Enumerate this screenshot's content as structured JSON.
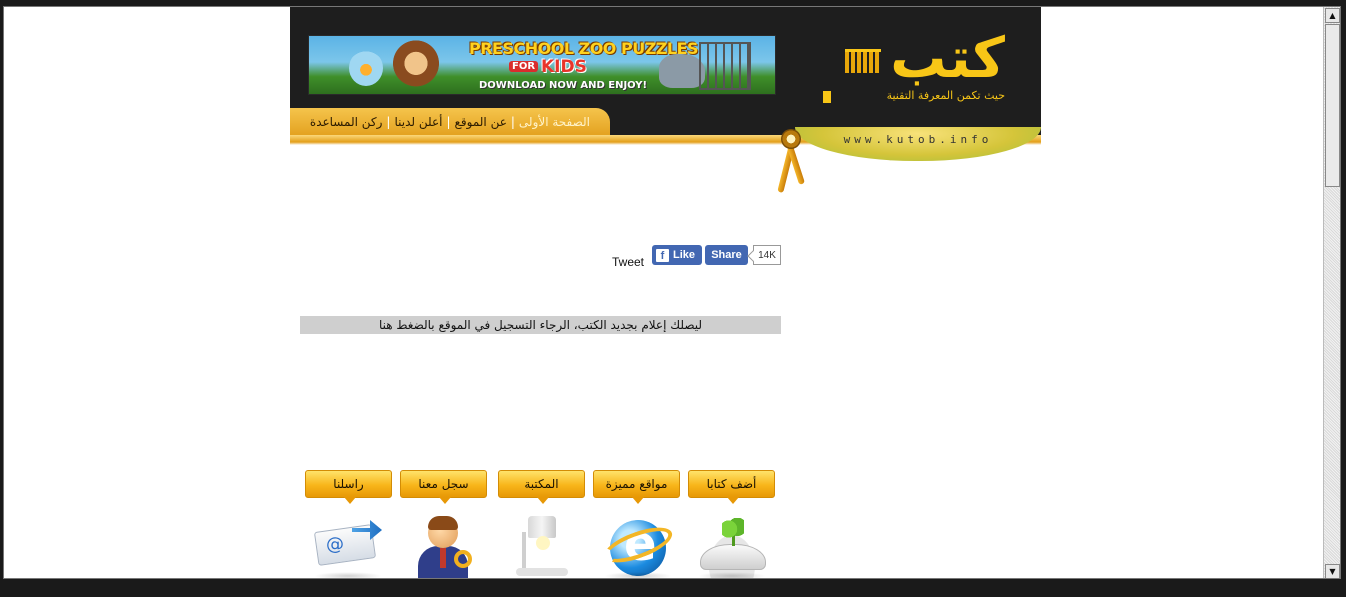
{
  "site": {
    "url_label": "www.kutob.info",
    "logo_text": "كتب",
    "logo_tagline": "حيث تكمن المعرفة التقنية"
  },
  "ad": {
    "title": "PRESCHOOL ZOO PUZZLES",
    "for_label": "FOR",
    "kids_label": "KIDS",
    "cta": "DOWNLOAD NOW AND ENJOY!"
  },
  "nav": {
    "items": [
      {
        "label": "الصفحة الأولى"
      },
      {
        "label": "عن الموقع"
      },
      {
        "label": "أعلن لدينا"
      },
      {
        "label": "ركن المساعدة"
      }
    ],
    "separator": "|"
  },
  "social": {
    "tweet_label": "Tweet",
    "like_label": "Like",
    "share_label": "Share",
    "like_count": "14K",
    "fb_glyph": "f"
  },
  "notice": {
    "text": "ليصلك إعلام بجديد الكتب، الرجاء التسجيل في الموقع بالضغط هنا"
  },
  "menu": {
    "buttons": [
      {
        "label": "أضف كتابا",
        "icon": "book-sprout-icon"
      },
      {
        "label": "مواقع مميزة",
        "icon": "internet-explorer-icon"
      },
      {
        "label": "المكتبة",
        "icon": "desk-lamp-icon"
      },
      {
        "label": "سجل معنا",
        "icon": "user-key-icon"
      },
      {
        "label": "راسلنا",
        "icon": "email-icon"
      }
    ]
  },
  "scrollbar": {
    "up_glyph": "▲",
    "down_glyph": "▼"
  },
  "colors": {
    "brand_gold": "#f8c617",
    "header_bg": "#1e1e1e",
    "facebook_blue": "#4267b2",
    "notice_bg": "#cfcfcf"
  }
}
